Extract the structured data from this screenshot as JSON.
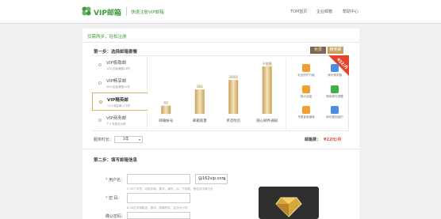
{
  "header": {
    "logo_text": "VIP邮箱",
    "slogan": "快速注册VIP邮箱",
    "nav": [
      "TOM首页",
      "企业邮箱",
      "帮助中心"
    ]
  },
  "page": {
    "tagline": "仅需两步，轻松注册",
    "step1_title": "第一步：选择邮箱套餐",
    "step2_title": "第二步：填写邮箱信息"
  },
  "plans": [
    {
      "name": "VIP极致邮",
      "desc": "12%流量满赠14项",
      "selected": false
    },
    {
      "name": "VIP畅享邮",
      "desc": "56%流量满赠10项",
      "selected": false
    },
    {
      "name": "VIP精英邮",
      "desc": "21%流量满入门项",
      "selected": true
    },
    {
      "name": "VIP商务邮",
      "desc": "个人专属安全邮",
      "selected": false
    }
  ],
  "badges": {
    "free": "免费",
    "selected": "精英邮",
    "corner_price": "¥22/月"
  },
  "chart_data": {
    "type": "bar",
    "categories": [
      "邮箱帐号",
      "邮箱容量",
      "单次附页",
      "随心邮件通知"
    ],
    "data_labels": [
      "6G",
      "18G",
      "200项",
      "不限量"
    ],
    "values": [
      6,
      18,
      25,
      35
    ]
  },
  "features": [
    {
      "label": "安全防护升级",
      "icon": "shield-icon",
      "color": "#f0a030"
    },
    {
      "label": "海外服务器",
      "icon": "globe-icon",
      "color": "#4a8ee0"
    },
    {
      "label": "超大容量",
      "icon": "storage-icon",
      "color": "#f0a030"
    },
    {
      "label": "微信邮件提醒",
      "icon": "wechat-icon",
      "color": "#3eb046"
    },
    {
      "label": "专属客服通道",
      "icon": "service-icon",
      "color": "#f0a030"
    },
    {
      "label": "邮件撤回保护",
      "icon": "recall-icon",
      "color": "#4a8ee0"
    }
  ],
  "duration": {
    "label": "服务时长：",
    "value": "1年"
  },
  "price": {
    "label": "邮箱费：",
    "value": "¥22元/月"
  },
  "form": {
    "username_label": "用户名：",
    "username_hint": "5-20个字符，可用字母、数字、减号、点、下划线，首位为字母开头",
    "domain": "@162vip.com",
    "password_label": "密 码：",
    "password_hint": "6-16位字母组合，数字、特殊符号，区分大小写",
    "confirm_label": "确认密码："
  },
  "colors": {
    "brand_green": "#3e9a3a",
    "gold": "#c9a15c",
    "red": "#e2452b"
  }
}
